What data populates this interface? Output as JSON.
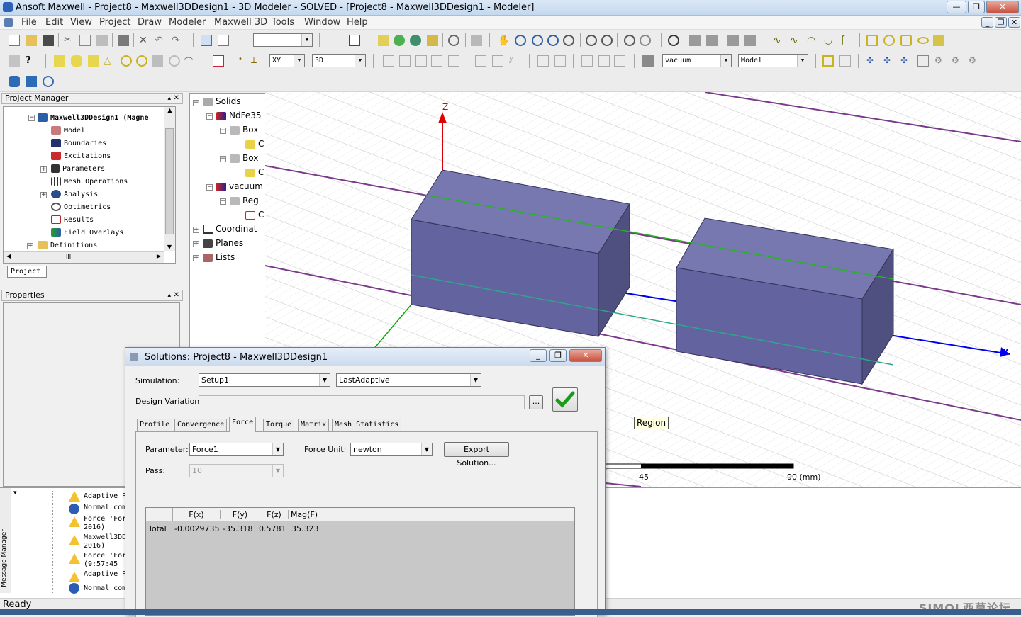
{
  "window": {
    "title": "Ansoft Maxwell  - Project8 - Maxwell3DDesign1 - 3D Modeler - SOLVED - [Project8 - Maxwell3DDesign1 - Modeler]",
    "controls": [
      "—",
      "❐",
      "✕"
    ],
    "child_controls": [
      "_",
      "❐",
      "✕"
    ]
  },
  "menu": [
    "File",
    "Edit",
    "View",
    "Project",
    "Draw",
    "Modeler",
    "Maxwell 3D",
    "Tools",
    "Window",
    "Help"
  ],
  "toolbar": {
    "plane": "XY",
    "view": "3D",
    "material": "vacuum",
    "mode": "Model"
  },
  "project_manager": {
    "title": "Project Manager",
    "root": "Maxwell3DDesign1 (Magne",
    "items": [
      "Model",
      "Boundaries",
      "Excitations",
      "Parameters",
      "Mesh Operations",
      "Analysis",
      "Optimetrics",
      "Results",
      "Field Overlays",
      "Definitions"
    ],
    "tab": "Project",
    "scroll_mark": "III"
  },
  "properties": {
    "title": "Properties"
  },
  "history_tree": {
    "items": [
      "Solids",
      "NdFe35",
      "Box",
      "Box",
      "vacuum",
      "Reg",
      "Coordinat",
      "Planes",
      "Lists"
    ],
    "stubs": [
      "C",
      "C",
      "C"
    ]
  },
  "viewport": {
    "axes": [
      "Z",
      "Y"
    ],
    "tooltip": "Region",
    "scale": {
      "mid": "45",
      "end": "90 (mm)"
    }
  },
  "messages": {
    "title": "Message Manager",
    "lines": [
      "Adaptive P",
      "Normal com",
      "Force 'For",
      "2016)",
      "Maxwell3DD",
      "2016)",
      "Force 'For",
      "(9:57:45",
      "Adaptive P",
      "Normal com"
    ]
  },
  "status": {
    "text": "Ready",
    "watermark": "SIMOL西莫论坛"
  },
  "dialog": {
    "title": "Solutions: Project8 - Maxwell3DDesign1",
    "simulation_label": "Simulation:",
    "simulation": "Setup1",
    "solution": "LastAdaptive",
    "variation_label": "Design Variation:",
    "variation_btn": "...",
    "tabs": [
      "Profile",
      "Convergence",
      "Force",
      "Torque",
      "Matrix",
      "Mesh Statistics"
    ],
    "parameter_label": "Parameter:",
    "parameter": "Force1",
    "unit_label": "Force Unit:",
    "unit": "newton",
    "export_btn": "Export Solution...",
    "pass_label": "Pass:",
    "pass": "10",
    "table": {
      "headers": [
        "",
        "F(x)",
        "F(y)",
        "F(z)",
        "Mag(F)"
      ],
      "row": {
        "label": "Total",
        "fx": "-0.0029735",
        "fy": "-35.318",
        "fz": "0.5781",
        "mag": "35.323"
      }
    }
  },
  "colors": {
    "block_top": "#7878b0",
    "block_front": "#6363a0",
    "block_side": "#4f4f80",
    "axis_z": "#dd0000",
    "axis_y": "#0000ee",
    "axis_x": "#00aa00",
    "edge_line": "#7a3a8a",
    "green_line": "#2bb02b"
  }
}
